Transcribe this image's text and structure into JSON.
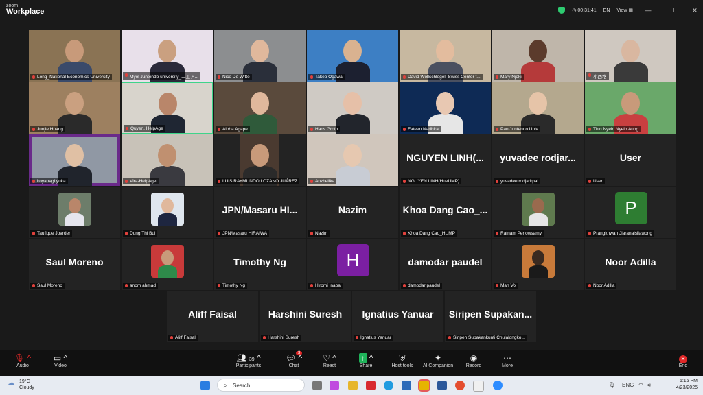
{
  "app": {
    "logo_top": "zoom",
    "logo_bottom": "Workplace"
  },
  "titlebar": {
    "timer": "00:31:41",
    "lang": "EN",
    "view": "View",
    "min": "—",
    "restore": "❐",
    "close": "✕"
  },
  "tiles": [
    {
      "label": "Long_National Economics University",
      "type": "video",
      "bg": "#8a7354",
      "skin": "#c89a7a",
      "shirt": "#3a4a6a"
    },
    {
      "label": "Myol Juntendo university_二工ア...",
      "type": "video",
      "bg": "#e8e0ea",
      "skin": "#caa080",
      "shirt": "#2a2a3a"
    },
    {
      "label": "Nico De Witte",
      "type": "video",
      "bg": "#8c8e90",
      "skin": "#e0b89c",
      "shirt": "#2a2f3a"
    },
    {
      "label": "Takeo Ogawa",
      "type": "video",
      "bg": "#3d7fc4",
      "skin": "#d9b290",
      "shirt": "#1c2030"
    },
    {
      "label": "David Wollschlegel, Swiss Center f...",
      "type": "video",
      "bg": "#c7b8a0",
      "skin": "#e3bc9e",
      "shirt": "#4a5060"
    },
    {
      "label": "Mary Njoki",
      "type": "video",
      "bg": "#bfb6aa",
      "skin": "#5b3b2c",
      "shirt": "#b53a3a"
    },
    {
      "label": "小西格",
      "type": "video",
      "bg": "#cfc8c0",
      "skin": "#d9b7a0",
      "shirt": "#3a3a3a"
    },
    {
      "label": "Junjie Huang",
      "type": "video",
      "bg": "#9d8060",
      "skin": "#caa080",
      "shirt": "#2a2a2a"
    },
    {
      "label": "Quyen, HelpAge",
      "type": "video",
      "speak": true,
      "bg": "#d8d4cc",
      "skin": "#b9866a",
      "shirt": "#1f2633"
    },
    {
      "label": "Alpha Agape",
      "type": "video",
      "bg": "#5a4a3c",
      "skin": "#e0b89c",
      "shirt": "#2f5a3a"
    },
    {
      "label": "Hans Groth",
      "type": "video",
      "bg": "#cfcac4",
      "skin": "#e6c0a8",
      "shirt": "#22252c"
    },
    {
      "label": "Fateen Nadhira",
      "type": "video",
      "bg": "#0e2a55",
      "skin": "#e8c8b2",
      "shirt": "#e6e6e6"
    },
    {
      "label": "Pan|Juntendo Univ",
      "type": "video",
      "bg": "#b4a88e",
      "skin": "#e6c4a8",
      "shirt": "#2a2a2a"
    },
    {
      "label": "Thin Nyein Nyein Aung",
      "type": "video",
      "bg": "#6aa86a",
      "skin": "#c89a7a",
      "shirt": "#c94040"
    },
    {
      "label": "koyanagi yuka",
      "type": "video",
      "bg": "#9098a4",
      "skin": "#e0c0a4",
      "shirt": "#20242c",
      "frame": "#6a2a8a"
    },
    {
      "label": "Vira-HelpAge",
      "type": "video",
      "bg": "#c8c2b8",
      "skin": "#c09070",
      "shirt": "#3a3a40"
    },
    {
      "label": "LUIS RAYMUNDO LOZANO JUÁREZ",
      "type": "video",
      "bg": "#4a3a30",
      "skin": "#c89a7a",
      "shirt": "#2a2a2a",
      "narrow": true
    },
    {
      "label": "Anzhelika",
      "type": "video",
      "bg": "#d0c6bc",
      "skin": "#e6c8b0",
      "shirt": "#c8ccd4"
    },
    {
      "label": "NGUYEN LINH(HueUMP)",
      "type": "name",
      "big": "NGUYEN LINH(..."
    },
    {
      "label": "yuvadee rodjarkpai",
      "type": "name",
      "big": "yuvadee rodjar..."
    },
    {
      "label": "User",
      "type": "name",
      "big": "User"
    },
    {
      "label": "Taufique Joarder",
      "type": "photo",
      "bg": "#6d7d6a",
      "skin": "#b9866a",
      "shirt": "#e6e6ee"
    },
    {
      "label": "Dung Thi Bui",
      "type": "photo",
      "bg": "#dfe6ee",
      "skin": "#e0b89c",
      "shirt": "#1e2640"
    },
    {
      "label": "JPN/Masaru HIRAIWA",
      "type": "name",
      "big": "JPN/Masaru HI..."
    },
    {
      "label": "Nazim",
      "type": "name",
      "big": "Nazim"
    },
    {
      "label": "Khoa Dang Cao_HUMP",
      "type": "name",
      "big": "Khoa Dang Cao_..."
    },
    {
      "label": "Ratnam Periowsamy",
      "type": "photo",
      "bg": "#5f7a4e",
      "skin": "#9a6a4e",
      "shirt": "#e6e6e6"
    },
    {
      "label": "Prangkhwan Jiaranaisilawong",
      "type": "avatar",
      "letter": "P",
      "color": "#2e7d32"
    },
    {
      "label": "Saul Moreno",
      "type": "name",
      "big": "Saul Moreno"
    },
    {
      "label": "anom ahmad",
      "type": "photo",
      "bg": "#c83a3a",
      "skin": "#c89a7a",
      "shirt": "#2e8a4a"
    },
    {
      "label": "Timothy Ng",
      "type": "name",
      "big": "Timothy Ng"
    },
    {
      "label": "Hiromi Inaba",
      "type": "avatar",
      "letter": "H",
      "color": "#7b1fa2"
    },
    {
      "label": "damodar paudel",
      "type": "name",
      "big": "damodar paudel"
    },
    {
      "label": "Man Vo",
      "type": "photo",
      "bg": "#c87a3a",
      "skin": "#3a2a20",
      "shirt": "#1a1a1a"
    },
    {
      "label": "Noor Adilla",
      "type": "name",
      "big": "Noor Adilla"
    },
    {
      "label": "Aliff Faisal",
      "type": "name",
      "big": "Aliff Faisal"
    },
    {
      "label": "Harshini Suresh",
      "type": "name",
      "big": "Harshini Suresh"
    },
    {
      "label": "Ignatius Yanuar",
      "type": "name",
      "big": "Ignatius Yanuar"
    },
    {
      "label": "Siripen Supakankunti Chulalongko...",
      "type": "name",
      "big": "Siripen Supakan..."
    }
  ],
  "toolbar": {
    "audio": "Audio",
    "video": "Video",
    "participants": "Participants",
    "participants_count": "39",
    "chat": "Chat",
    "chat_badge": "3",
    "react": "React",
    "share": "Share",
    "host_tools": "Host tools",
    "ai": "AI Companion",
    "record": "Record",
    "more": "More",
    "end": "End"
  },
  "taskbar": {
    "temp": "19°C",
    "weather": "Cloudy",
    "search": "Search",
    "lang": "ENG",
    "time": "6:16 PM",
    "date": "4/23/2025"
  }
}
